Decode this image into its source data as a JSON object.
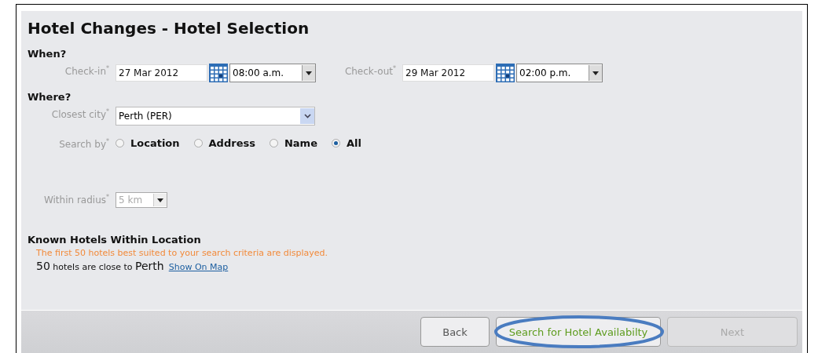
{
  "title": "Hotel Changes - Hotel Selection",
  "when": {
    "heading": "When?",
    "fields": [
      {
        "label": "Check-in$^{*}$",
        "date": "27 Mar 2012",
        "time": "08:00 a.m."
      },
      {
        "label": "Check-out$^{*}$",
        "date": "29 Mar 2012",
        "time": "02:00 p.m."
      }
    ]
  },
  "where": {
    "heading": "Where?",
    "city_label": "Closest city$^{*}$",
    "city": "Perth (PER)",
    "search_by_label": "Search by$^{*}$",
    "search_by": [
      {
        "label": "Location",
        "selected": false
      },
      {
        "label": "Address",
        "selected": false
      },
      {
        "label": "Name",
        "selected": false
      },
      {
        "label": "All",
        "selected": true
      }
    ],
    "radius_label": "Within radius$^{*}$",
    "radius": "5 km",
    "radius_disabled": true
  },
  "known": {
    "heading": "Known Hotels Within Location",
    "note": "The first 50 hotels best suited to your search criteria are displayed.",
    "summary": "**50** hotels are close to **Perth**",
    "link": "Show On Map"
  },
  "buttons": [
    {
      "label": "Back",
      "kind": "normal",
      "disabled": false,
      "circled": false
    },
    {
      "label": "Search for Hotel Availabilty",
      "kind": "primary",
      "disabled": false,
      "circled": true
    },
    {
      "label": "Next",
      "kind": "normal",
      "disabled": true,
      "circled": false
    }
  ]
}
